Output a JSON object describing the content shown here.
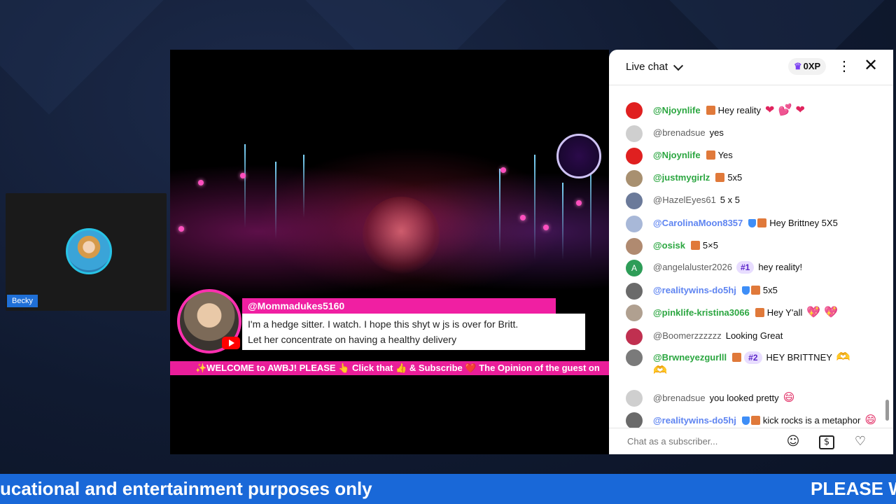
{
  "participant": {
    "name": "Becky"
  },
  "superchat": {
    "author": "@Mommadukes5160",
    "message_line1": "I'm a hedge sitter. I watch. I hope this shyt w js is over for Britt.",
    "message_line2": "Let her concentrate on having a healthy delivery"
  },
  "ticker": {
    "text": "✨WELCOME to AWBJ! PLEASE 👆 Click that 👍 & Subscribe ❤️ The Opinion of the guest on"
  },
  "chat": {
    "title": "Live chat",
    "xp": "0XP",
    "close_label": "✕",
    "menu_label": "⋮",
    "input_placeholder": "Chat as a subscriber...",
    "messages": [
      {
        "author": "@Njoynlife",
        "text": "Hey reality",
        "emoji": "❤ 💕 ❤",
        "rank": "",
        "avatar_color": "#e02020"
      },
      {
        "author": "@brenadsue",
        "text": "yes",
        "emoji": "",
        "rank": "",
        "avatar_color": "#cfcfcf"
      },
      {
        "author": "@Njoynlife",
        "text": "Yes",
        "emoji": "",
        "rank": "",
        "avatar_color": "#e02020"
      },
      {
        "author": "@justmygirlz",
        "text": "5x5",
        "emoji": "",
        "rank": "",
        "avatar_color": "#a89070"
      },
      {
        "author": "@HazelEyes61",
        "text": "5 x 5",
        "emoji": "",
        "rank": "",
        "avatar_color": "#6b7a9a"
      },
      {
        "author": "@CarolinaMoon8357",
        "text": "Hey Brittney 5X5",
        "emoji": "",
        "rank": "",
        "avatar_color": "#a8b8d8"
      },
      {
        "author": "@osisk",
        "text": "5×5",
        "emoji": "",
        "rank": "",
        "avatar_color": "#b08a70"
      },
      {
        "author": "@angelaluster2026",
        "text": "hey reality!",
        "emoji": "",
        "rank": "#1",
        "avatar_color": "#2e9d58",
        "avatar_letter": "A"
      },
      {
        "author": "@realitywins-do5hj",
        "text": "5x5",
        "emoji": "",
        "rank": "",
        "avatar_color": "#6a6a6a"
      },
      {
        "author": "@pinklife-kristina3066",
        "text": "Hey Y'all",
        "emoji": "💖 💖",
        "rank": "",
        "avatar_color": "#b0a090"
      },
      {
        "author": "@Boomerzzzzzz",
        "text": "Looking Great",
        "emoji": "",
        "rank": "",
        "avatar_color": "#c03050"
      },
      {
        "author": "@Brwneyezgurlll",
        "text": "HEY BRITTNEY",
        "emoji": "🫶",
        "emoji2": "🫶",
        "rank": "#2",
        "avatar_color": "#7a7a7a"
      },
      {
        "author": "@brenadsue",
        "text": "you looked pretty",
        "emoji": "😄",
        "rank": "",
        "avatar_color": "#cfcfcf"
      },
      {
        "author": "@realitywins-do5hj",
        "text": "kick rocks is a metaphor",
        "emoji": "😄",
        "rank": "",
        "avatar_color": "#6a6a6a"
      }
    ]
  },
  "marquee": {
    "left_text": "ucational and entertainment purposes only",
    "right_text": "PLEASE W"
  },
  "icons": {
    "emoji_button": "☺",
    "superchat_button": "$",
    "heart_button": "♡",
    "crown": "♛"
  }
}
